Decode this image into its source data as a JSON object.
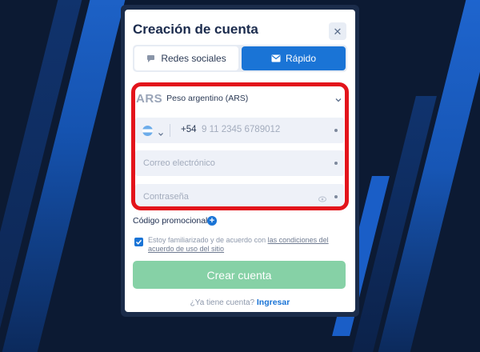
{
  "modal": {
    "title": "Creación de cuenta",
    "close_icon": "close-icon"
  },
  "tabs": [
    {
      "label": "Redes sociales",
      "icon": "chat-bubble-icon",
      "active": false
    },
    {
      "label": "Rápido",
      "icon": "envelope-icon",
      "active": true
    }
  ],
  "currency": {
    "code": "ARS",
    "name": "Peso argentino (ARS)"
  },
  "phone": {
    "country_flag": "argentina-flag",
    "prefix": "+54",
    "placeholder": "9 11 2345 6789012"
  },
  "email": {
    "placeholder": "Correo electrónico"
  },
  "password": {
    "placeholder": "Contraseña"
  },
  "promo": {
    "label": "Código promocional"
  },
  "terms": {
    "text": "Estoy familiarizado y de acuerdo con",
    "link": "las condiciones del acuerdo de uso del sitio",
    "checked": true
  },
  "submit": {
    "label": "Crear cuenta"
  },
  "login": {
    "question": "¿Ya tiene cuenta?",
    "link": "Ingresar"
  },
  "colors": {
    "accent": "#1a74d6",
    "button": "#86d1a6",
    "highlight": "#e3141b",
    "background": "#0c1a33"
  }
}
